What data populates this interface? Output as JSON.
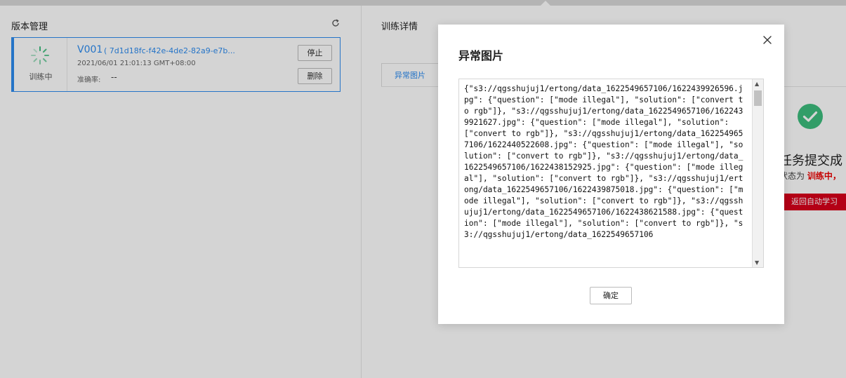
{
  "left_panel": {
    "title": "版本管理",
    "version_card": {
      "status_label": "训练中",
      "version_name": "V001",
      "version_hash": "( 7d1d18fc-f42e-4de2-82a9-e7b...",
      "created_time": "2021/06/01 21:01:13 GMT+08:00",
      "accuracy_label": "准确率:",
      "accuracy_value": "--",
      "stop_label": "停止",
      "delete_label": "删除"
    }
  },
  "right_panel": {
    "title": "训练详情",
    "tab_label": "异常图片",
    "success_title": "任务提交成",
    "success_desc_prefix": "状态为 ",
    "success_desc_highlight": "训练中，",
    "back_button_label": "返回自动学习"
  },
  "modal": {
    "title": "异常图片",
    "content": "{\"s3://qgsshujuj1/ertong/data_1622549657106/1622439926596.jpg\": {\"question\": [\"mode illegal\"], \"solution\": [\"convert to rgb\"]}, \"s3://qgsshujuj1/ertong/data_1622549657106/1622439921627.jpg\": {\"question\": [\"mode illegal\"], \"solution\": [\"convert to rgb\"]}, \"s3://qgsshujuj1/ertong/data_1622549657106/1622440522608.jpg\": {\"question\": [\"mode illegal\"], \"solution\": [\"convert to rgb\"]}, \"s3://qgsshujuj1/ertong/data_1622549657106/1622438152925.jpg\": {\"question\": [\"mode illegal\"], \"solution\": [\"convert to rgb\"]}, \"s3://qgsshujuj1/ertong/data_1622549657106/1622439875018.jpg\": {\"question\": [\"mode illegal\"], \"solution\": [\"convert to rgb\"]}, \"s3://qgsshujuj1/ertong/data_1622549657106/1622438621588.jpg\": {\"question\": [\"mode illegal\"], \"solution\": [\"convert to rgb\"]}, \"s3://qgsshujuj1/ertong/data_1622549657106",
    "confirm_label": "确定"
  },
  "colors": {
    "accent": "#2d8cf0",
    "success": "#3dbd7d",
    "danger": "#d9001b"
  },
  "icons": {
    "refresh": "refresh-icon",
    "spinner": "loading-spinner-icon",
    "success": "check-circle-icon",
    "close": "close-icon"
  }
}
